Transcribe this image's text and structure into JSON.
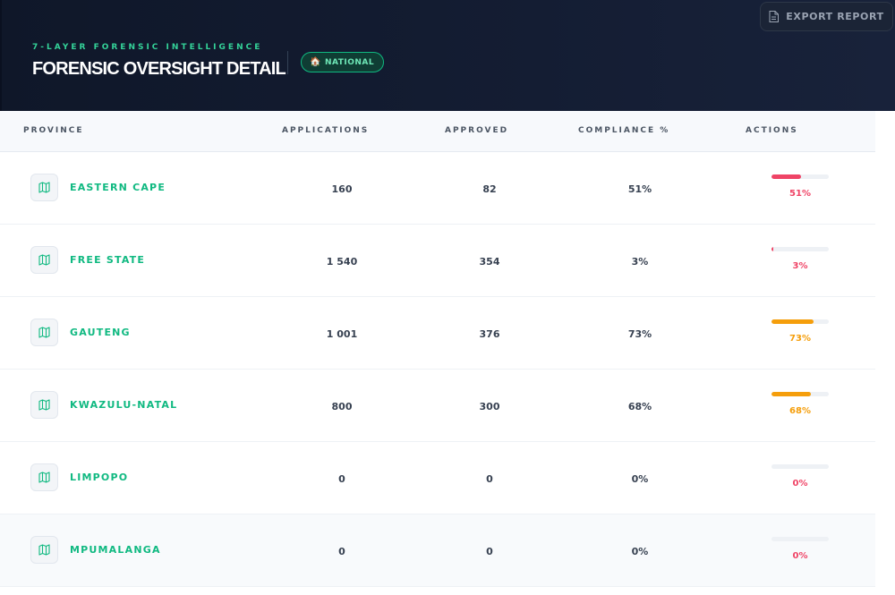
{
  "header": {
    "eyebrow": "7-LAYER FORENSIC INTELLIGENCE",
    "title": "FORENSIC OVERSIGHT DETAIL",
    "badge": {
      "icon": "house-icon",
      "label": "NATIONAL"
    },
    "export_button": {
      "icon": "document-icon",
      "label": "EXPORT REPORT"
    }
  },
  "table": {
    "columns": [
      "PROVINCE",
      "APPLICATIONS",
      "APPROVED",
      "COMPLIANCE %",
      "ACTIONS"
    ],
    "rows": [
      {
        "province": "EASTERN CAPE",
        "applications": "160",
        "approved": "82",
        "compliance": "51%",
        "bar_fraction": 0.51,
        "bar_label": "51%",
        "status_color": "#ef4466"
      },
      {
        "province": "FREE STATE",
        "applications": "1 540",
        "approved": "354",
        "compliance": "3%",
        "bar_fraction": 0.03,
        "bar_label": "3%",
        "status_color": "#ef4466"
      },
      {
        "province": "GAUTENG",
        "applications": "1 001",
        "approved": "376",
        "compliance": "73%",
        "bar_fraction": 0.73,
        "bar_label": "73%",
        "status_color": "#f59e0b"
      },
      {
        "province": "KWAZULU-NATAL",
        "applications": "800",
        "approved": "300",
        "compliance": "68%",
        "bar_fraction": 0.68,
        "bar_label": "68%",
        "status_color": "#f59e0b"
      },
      {
        "province": "LIMPOPO",
        "applications": "0",
        "approved": "0",
        "compliance": "0%",
        "bar_fraction": 0,
        "bar_label": "0%",
        "status_color": "#ef4466"
      },
      {
        "province": "MPUMALANGA",
        "applications": "0",
        "approved": "0",
        "compliance": "0%",
        "bar_fraction": 0,
        "bar_label": "0%",
        "status_color": "#ef4466"
      }
    ],
    "row_icon": "map-icon"
  },
  "colors": {
    "accent": "#10b981",
    "danger": "#ef4466",
    "warning": "#f59e0b",
    "header_bg": "#0f1729"
  }
}
